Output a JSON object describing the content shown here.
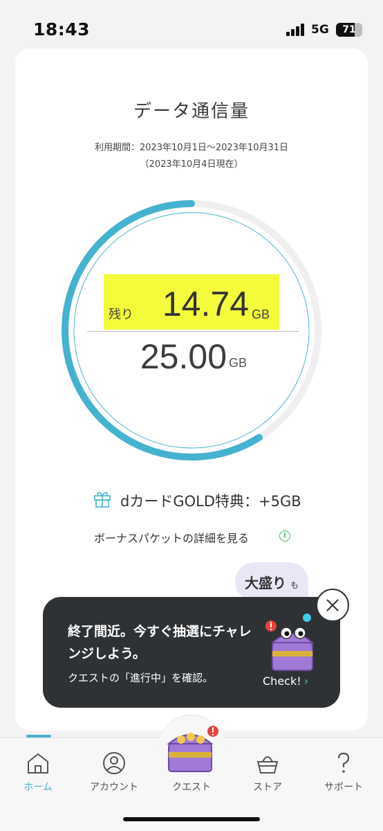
{
  "status_bar": {
    "time": "18:43",
    "network": "5G",
    "battery": "71",
    "battery_level": 0.71
  },
  "card": {
    "title": "データ通信量",
    "period": "利用期間：2023年10月1日〜2023年10月31日",
    "as_of": "（2023年10月4日現在）",
    "remaining_label": "残り",
    "remaining_value": "14.74",
    "remaining_unit": "GB",
    "total_value": "25.00",
    "total_unit": "GB",
    "usage_fraction_remaining": 0.5896,
    "bonus_text": "dカードGOLD特典：+5GB",
    "bonus_link": "ボーナスパケットの詳細を見る",
    "promo_bubble": "大盛り",
    "promo_bubble_suffix": "も"
  },
  "popup": {
    "title": "終了間近。今すぐ抽選にチャレンジしよう。",
    "subtitle": "クエストの「進行中」を確認。",
    "check_label": "Check!"
  },
  "tabbar": {
    "items": [
      {
        "label": "ホーム",
        "icon": "home-icon",
        "active": true
      },
      {
        "label": "アカウント",
        "icon": "user-icon",
        "active": false
      },
      {
        "label": "クエスト",
        "icon": "treasure-chest-icon",
        "active": false
      },
      {
        "label": "ストア",
        "icon": "basket-icon",
        "active": false
      },
      {
        "label": "サポート",
        "icon": "question-icon",
        "active": false
      }
    ]
  },
  "colors": {
    "accent": "#45b2cf",
    "highlight": "#f4fb3b",
    "popup_bg": "#2f3235",
    "check_chevron": "#3dd08a"
  }
}
